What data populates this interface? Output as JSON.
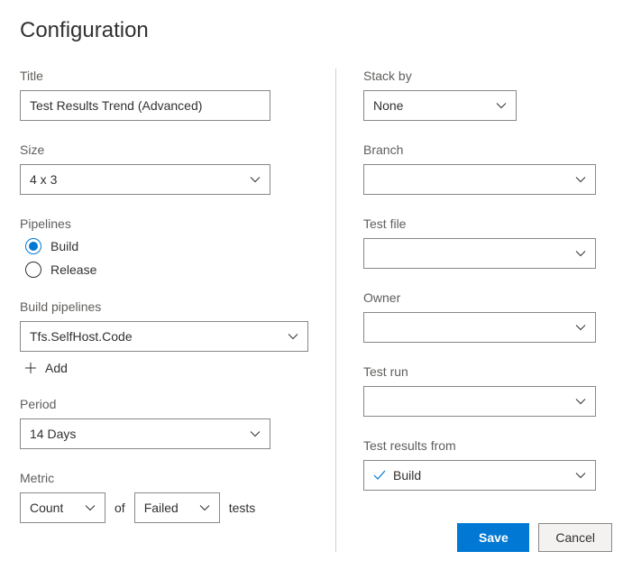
{
  "header": {
    "title": "Configuration"
  },
  "left": {
    "title_label": "Title",
    "title_value": "Test Results Trend (Advanced)",
    "size_label": "Size",
    "size_value": "4 x 3",
    "pipelines_label": "Pipelines",
    "radio_build": "Build",
    "radio_release": "Release",
    "build_pipelines_label": "Build pipelines",
    "build_pipelines_value": "Tfs.SelfHost.Code",
    "add_label": "Add",
    "period_label": "Period",
    "period_value": "14 Days",
    "metric_label": "Metric",
    "metric_count": "Count",
    "metric_of": "of",
    "metric_failed": "Failed",
    "metric_tests": "tests"
  },
  "right": {
    "stack_by_label": "Stack by",
    "stack_by_value": "None",
    "branch_label": "Branch",
    "branch_value": "",
    "test_file_label": "Test file",
    "test_file_value": "",
    "owner_label": "Owner",
    "owner_value": "",
    "test_run_label": "Test run",
    "test_run_value": "",
    "test_results_from_label": "Test results from",
    "test_results_from_value": "Build"
  },
  "buttons": {
    "save": "Save",
    "cancel": "Cancel"
  }
}
